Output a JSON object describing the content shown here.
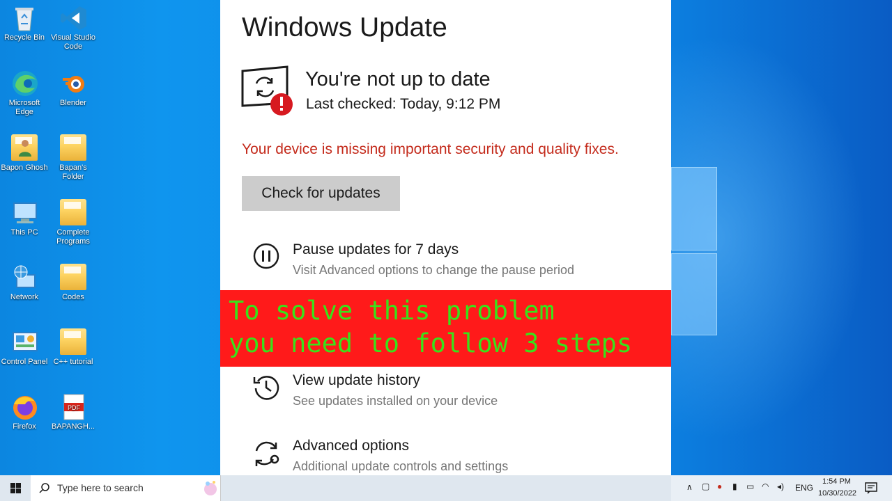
{
  "desktop": {
    "icons": [
      {
        "label": "Recycle Bin"
      },
      {
        "label": "Visual Studio Code"
      },
      {
        "label": "Microsoft Edge"
      },
      {
        "label": "Blender"
      },
      {
        "label": "Bapon Ghosh"
      },
      {
        "label": "Bapan's Folder"
      },
      {
        "label": "This PC"
      },
      {
        "label": "Complete Programs"
      },
      {
        "label": "Network"
      },
      {
        "label": "Codes"
      },
      {
        "label": "Control Panel"
      },
      {
        "label": "C++ tutorial"
      },
      {
        "label": "Firefox"
      },
      {
        "label": "BAPANGH..."
      }
    ]
  },
  "update": {
    "title": "Windows Update",
    "status_heading": "You're not up to date",
    "last_checked": "Last checked: Today, 9:12 PM",
    "warning": "Your device is missing important security and quality fixes.",
    "check_button": "Check for updates",
    "options": [
      {
        "title": "Pause updates for 7 days",
        "subtitle": "Visit Advanced options to change the pause period",
        "icon": "pause-icon"
      },
      {
        "title": "View update history",
        "subtitle": "See updates installed on your device",
        "icon": "history-icon"
      },
      {
        "title": "Advanced options",
        "subtitle": "Additional update controls and settings",
        "icon": "advanced-sync-icon"
      }
    ]
  },
  "banner": {
    "line1": "To solve this problem",
    "line2": "you need to follow 3 steps"
  },
  "taskbar": {
    "search_placeholder": "Type here to search",
    "language": "ENG",
    "time": "1:54 PM",
    "date": "10/30/2022"
  },
  "colors": {
    "warning_red": "#c42b1c",
    "banner_bg": "#ff1a1a",
    "banner_text": "#39e21a",
    "desktop_blue": "#0c86e0"
  }
}
